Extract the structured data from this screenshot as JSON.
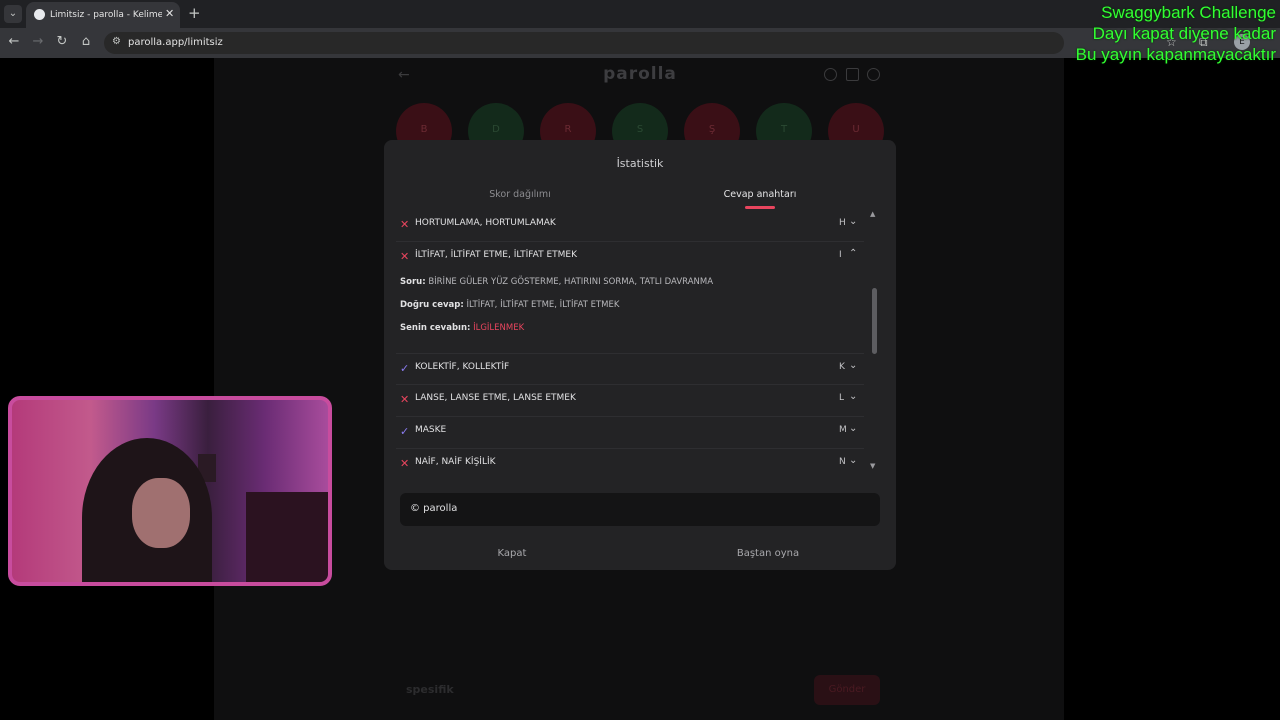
{
  "browser": {
    "tab_title": "Limitsiz - parolla - Kelime oyunu",
    "url": "parolla.app/limitsiz"
  },
  "app": {
    "logo": "parolla",
    "letters": [
      "B",
      "D",
      "R",
      "S",
      "Ş",
      "T",
      "U"
    ],
    "bottom_input": "spesifik",
    "bottom_button": "Gönder"
  },
  "modal": {
    "title": "İstatistik",
    "tabs": [
      "Skor dağılımı",
      "Cevap anahtarı"
    ],
    "active_tab": "Cevap anahtarı",
    "rows": [
      {
        "status": "wrong",
        "label": "HORTUMLAMA, HORTUMLAMAK",
        "letter": "H",
        "expanded": false
      },
      {
        "status": "wrong",
        "label": "İLTİFAT, İLTİFAT ETME, İLTİFAT ETMEK",
        "letter": "I",
        "expanded": true
      },
      {
        "status": "correct",
        "label": "KOLEKTİF, KOLLEKTİF",
        "letter": "K",
        "expanded": false
      },
      {
        "status": "wrong",
        "label": "LANSE, LANSE ETME, LANSE ETMEK",
        "letter": "L",
        "expanded": false
      },
      {
        "status": "correct",
        "label": "MASKE",
        "letter": "M",
        "expanded": false
      },
      {
        "status": "wrong",
        "label": "NAİF, NAİF KİŞİLİK",
        "letter": "N",
        "expanded": false
      }
    ],
    "detail": {
      "question_label": "Soru:",
      "question": "BİRİNE GÜLER YÜZ GÖSTERME, HATIRINI SORMA, TATLI DAVRANMA",
      "correct_label": "Doğru cevap:",
      "correct": "İLTİFAT, İLTİFAT ETME, İLTİFAT ETMEK",
      "yours_label": "Senin cevabın:",
      "yours": "İLGİLENMEK"
    },
    "copyright": "© parolla",
    "close_button": "Kapat",
    "restart_button": "Baştan oyna"
  },
  "overlay": {
    "line1": "Swaggybark Challenge",
    "line2": "Dayı kapat diyene kadar",
    "line3": "Bu yayın kapanmayacaktır"
  },
  "colors": {
    "accent": "#e8455e",
    "correct": "#8b7cf0",
    "overlay_text": "#32ff32"
  }
}
